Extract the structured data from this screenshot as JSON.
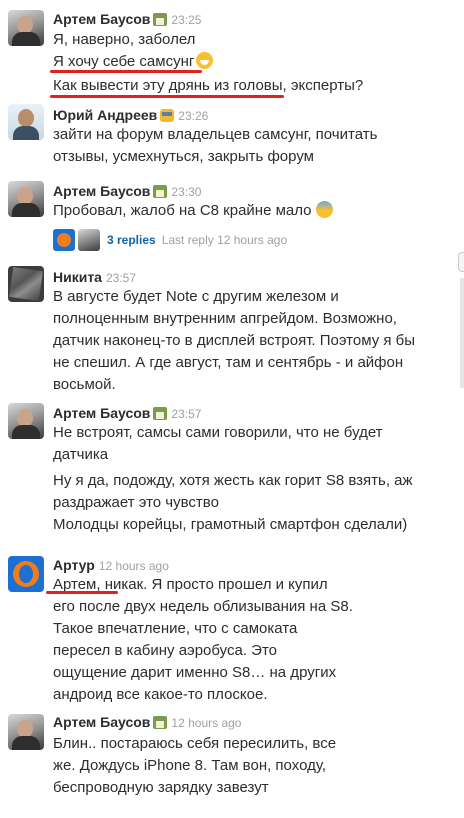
{
  "messages": [
    {
      "author": "Артем Баусов",
      "time": "23:25",
      "lines": [
        "Я, наверно, заболел",
        "Я хочу себе самсунг",
        "Как вывести эту дрянь из головы, эксперты?"
      ]
    },
    {
      "author": "Юрий Андреев",
      "time": "23:26",
      "lines": [
        "зайти на форум владельцев самсунг, почитать",
        "отзывы, усмехнуться, закрыть форум"
      ]
    },
    {
      "author": "Артем Баусов",
      "time": "23:30",
      "lines": [
        "Пробовал, жалоб на С8 крайне мало"
      ],
      "thread": {
        "replies": "3 replies",
        "last_reply": "Last reply 12 hours ago"
      }
    },
    {
      "author": "Никита",
      "time": "23:57",
      "lines": [
        "В августе будет Note с другим железом и",
        "полноценным внутренним апгрейдом. Возможно,",
        "датчик наконец-то в дисплей встроят. Поэтому я бы",
        "не спешил. А где август, там и сентябрь - и айфон",
        "восьмой."
      ]
    },
    {
      "author": "Артем Баусов",
      "time": "23:57",
      "lines": [
        "Не встроят, самсы сами говорили, что не будет",
        "датчика",
        "Ну я да, подожду, хотя жесть как горит S8 взять, аж",
        "раздражает это чувство",
        "Молодцы корейцы, грамотный смартфон сделали)"
      ]
    },
    {
      "author": "Артур",
      "time": "12 hours ago",
      "lines": [
        "Артем, никак. Я просто прошел и купил",
        "его после двух недель облизывания на S8.",
        "Такое впечатление, что с самоката",
        "пересел в кабину аэробуса. Это",
        "ощущение дарит именно S8… на других",
        "андроид все какое-то плоское."
      ]
    },
    {
      "author": "Артем Баусов",
      "time": "12 hours ago",
      "lines": [
        "Блин.. постараюсь себя пересилить, все",
        "же. Дождусь iPhone 8. Там вон, походу,",
        "беспроводную зарядку завезут"
      ]
    }
  ],
  "icons": {
    "status_artem": "house-with-garden-icon",
    "status_yuri": "bus-icon",
    "emoji_grin": "grinning-face-icon",
    "emoji_fear": "fearful-face-icon"
  },
  "colors": {
    "underline": "#e0221e",
    "link": "#1264a3",
    "muted": "#a0a0a2"
  }
}
